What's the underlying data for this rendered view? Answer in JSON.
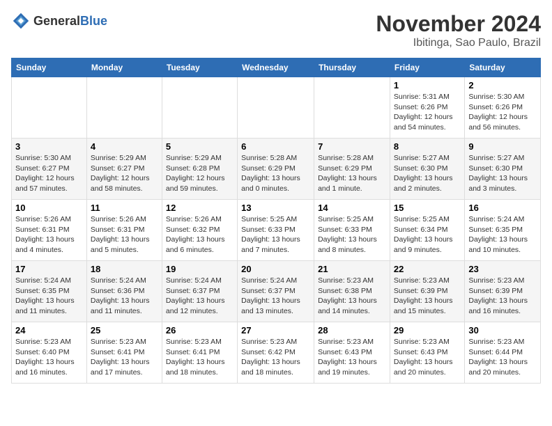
{
  "header": {
    "logo_general": "General",
    "logo_blue": "Blue",
    "title": "November 2024",
    "subtitle": "Ibitinga, Sao Paulo, Brazil"
  },
  "weekdays": [
    "Sunday",
    "Monday",
    "Tuesday",
    "Wednesday",
    "Thursday",
    "Friday",
    "Saturday"
  ],
  "weeks": [
    [
      null,
      null,
      null,
      null,
      null,
      {
        "day": "1",
        "sunrise": "5:31 AM",
        "sunset": "6:26 PM",
        "daylight": "12 hours and 54 minutes."
      },
      {
        "day": "2",
        "sunrise": "5:30 AM",
        "sunset": "6:26 PM",
        "daylight": "12 hours and 56 minutes."
      }
    ],
    [
      {
        "day": "3",
        "sunrise": "5:30 AM",
        "sunset": "6:27 PM",
        "daylight": "12 hours and 57 minutes."
      },
      {
        "day": "4",
        "sunrise": "5:29 AM",
        "sunset": "6:27 PM",
        "daylight": "12 hours and 58 minutes."
      },
      {
        "day": "5",
        "sunrise": "5:29 AM",
        "sunset": "6:28 PM",
        "daylight": "12 hours and 59 minutes."
      },
      {
        "day": "6",
        "sunrise": "5:28 AM",
        "sunset": "6:29 PM",
        "daylight": "13 hours and 0 minutes."
      },
      {
        "day": "7",
        "sunrise": "5:28 AM",
        "sunset": "6:29 PM",
        "daylight": "13 hours and 1 minute."
      },
      {
        "day": "8",
        "sunrise": "5:27 AM",
        "sunset": "6:30 PM",
        "daylight": "13 hours and 2 minutes."
      },
      {
        "day": "9",
        "sunrise": "5:27 AM",
        "sunset": "6:30 PM",
        "daylight": "13 hours and 3 minutes."
      }
    ],
    [
      {
        "day": "10",
        "sunrise": "5:26 AM",
        "sunset": "6:31 PM",
        "daylight": "13 hours and 4 minutes."
      },
      {
        "day": "11",
        "sunrise": "5:26 AM",
        "sunset": "6:31 PM",
        "daylight": "13 hours and 5 minutes."
      },
      {
        "day": "12",
        "sunrise": "5:26 AM",
        "sunset": "6:32 PM",
        "daylight": "13 hours and 6 minutes."
      },
      {
        "day": "13",
        "sunrise": "5:25 AM",
        "sunset": "6:33 PM",
        "daylight": "13 hours and 7 minutes."
      },
      {
        "day": "14",
        "sunrise": "5:25 AM",
        "sunset": "6:33 PM",
        "daylight": "13 hours and 8 minutes."
      },
      {
        "day": "15",
        "sunrise": "5:25 AM",
        "sunset": "6:34 PM",
        "daylight": "13 hours and 9 minutes."
      },
      {
        "day": "16",
        "sunrise": "5:24 AM",
        "sunset": "6:35 PM",
        "daylight": "13 hours and 10 minutes."
      }
    ],
    [
      {
        "day": "17",
        "sunrise": "5:24 AM",
        "sunset": "6:35 PM",
        "daylight": "13 hours and 11 minutes."
      },
      {
        "day": "18",
        "sunrise": "5:24 AM",
        "sunset": "6:36 PM",
        "daylight": "13 hours and 11 minutes."
      },
      {
        "day": "19",
        "sunrise": "5:24 AM",
        "sunset": "6:37 PM",
        "daylight": "13 hours and 12 minutes."
      },
      {
        "day": "20",
        "sunrise": "5:24 AM",
        "sunset": "6:37 PM",
        "daylight": "13 hours and 13 minutes."
      },
      {
        "day": "21",
        "sunrise": "5:23 AM",
        "sunset": "6:38 PM",
        "daylight": "13 hours and 14 minutes."
      },
      {
        "day": "22",
        "sunrise": "5:23 AM",
        "sunset": "6:39 PM",
        "daylight": "13 hours and 15 minutes."
      },
      {
        "day": "23",
        "sunrise": "5:23 AM",
        "sunset": "6:39 PM",
        "daylight": "13 hours and 16 minutes."
      }
    ],
    [
      {
        "day": "24",
        "sunrise": "5:23 AM",
        "sunset": "6:40 PM",
        "daylight": "13 hours and 16 minutes."
      },
      {
        "day": "25",
        "sunrise": "5:23 AM",
        "sunset": "6:41 PM",
        "daylight": "13 hours and 17 minutes."
      },
      {
        "day": "26",
        "sunrise": "5:23 AM",
        "sunset": "6:41 PM",
        "daylight": "13 hours and 18 minutes."
      },
      {
        "day": "27",
        "sunrise": "5:23 AM",
        "sunset": "6:42 PM",
        "daylight": "13 hours and 18 minutes."
      },
      {
        "day": "28",
        "sunrise": "5:23 AM",
        "sunset": "6:43 PM",
        "daylight": "13 hours and 19 minutes."
      },
      {
        "day": "29",
        "sunrise": "5:23 AM",
        "sunset": "6:43 PM",
        "daylight": "13 hours and 20 minutes."
      },
      {
        "day": "30",
        "sunrise": "5:23 AM",
        "sunset": "6:44 PM",
        "daylight": "13 hours and 20 minutes."
      }
    ]
  ]
}
